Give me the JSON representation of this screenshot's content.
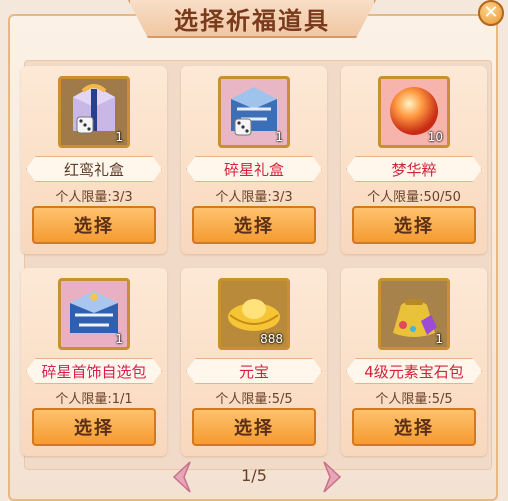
{
  "title": "选择祈福道具",
  "close": "✕",
  "select_label": "选择",
  "items": [
    {
      "name": "红鸾礼盒",
      "limit": "个人限量:3/3",
      "count": "1",
      "name_color": "gray",
      "icon": "red-phoenix-gift-box-icon"
    },
    {
      "name": "碎星礼盒",
      "limit": "个人限量:3/3",
      "count": "1",
      "name_color": "red",
      "icon": "star-fragment-gift-box-icon"
    },
    {
      "name": "梦华粹",
      "limit": "个人限量:50/50",
      "count": "10",
      "name_color": "red",
      "icon": "dream-essence-orb-icon"
    },
    {
      "name": "碎星首饰自选包",
      "limit": "个人限量:1/1",
      "count": "1",
      "name_color": "pink",
      "icon": "jewelry-selection-box-icon"
    },
    {
      "name": "元宝",
      "limit": "个人限量:5/5",
      "count": "888",
      "name_color": "red",
      "icon": "gold-ingot-icon"
    },
    {
      "name": "4级元素宝石包",
      "limit": "个人限量:5/5",
      "count": "1",
      "name_color": "red",
      "icon": "gem-bag-icon"
    }
  ],
  "pager": {
    "text": "1/5"
  }
}
